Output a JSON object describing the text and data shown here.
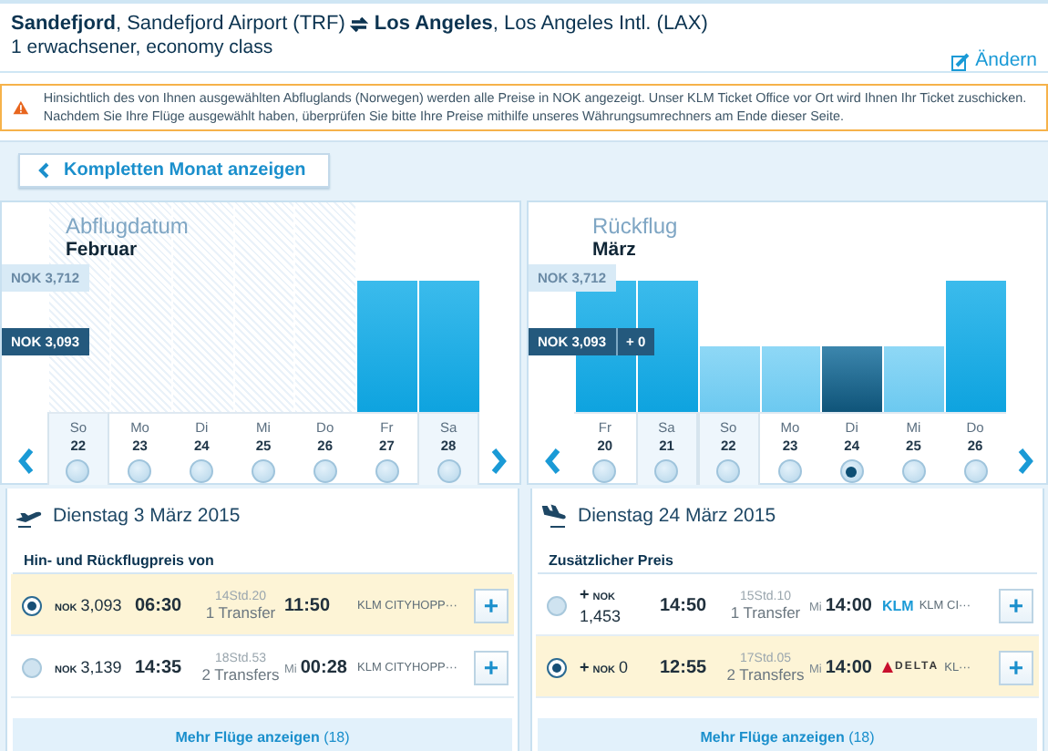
{
  "route": {
    "origin": "**Sandefjord**, Sandefjord Airport (TRF)",
    "destination": "**Los Angeles**, Los Angeles Intl. (LAX)",
    "passengers": "1 erwachsener, economy class",
    "edit_link": "Ändern"
  },
  "notice": {
    "text": "Hinsichtlich des von Ihnen ausgewählten Abfluglands (Norwegen) werden alle Preise in NOK angezeigt. Unser KLM Ticket Office vor Ort wird Ihnen Ihr Ticket zuschicken. Nachdem Sie Ihre Flüge ausgewählt haben, überprüfen Sie bitte Ihre Preise mithilfe unseres Währungsumrechners am Ende dieser Seite."
  },
  "month_button": {
    "label": "Kompletten Monat anzeigen"
  },
  "calendars": [
    {
      "title": "Abflugdatum",
      "month": "Februar",
      "price_tags": [
        {
          "kind": "high",
          "label": "NOK 3,712"
        },
        {
          "kind": "low",
          "label": "NOK 3,093"
        }
      ],
      "days": [
        {
          "weekday": "So",
          "date": "22",
          "kind": "unavailable",
          "weekend": true,
          "selected": false
        },
        {
          "weekday": "Mo",
          "date": "23",
          "kind": "unavailable",
          "weekend": false,
          "selected": false
        },
        {
          "weekday": "Di",
          "date": "24",
          "kind": "unavailable",
          "weekend": false,
          "selected": false
        },
        {
          "weekday": "Mi",
          "date": "25",
          "kind": "unavailable",
          "weekend": false,
          "selected": false
        },
        {
          "weekday": "Do",
          "date": "26",
          "kind": "unavailable",
          "weekend": false,
          "selected": false
        },
        {
          "weekday": "Fr",
          "date": "27",
          "kind": "high",
          "weekend": false,
          "selected": false
        },
        {
          "weekday": "Sa",
          "date": "28",
          "kind": "high",
          "weekend": true,
          "selected": false
        }
      ]
    },
    {
      "title": "Rückflug",
      "month": "März",
      "price_tags": [
        {
          "kind": "high",
          "label": "NOK 3,712"
        },
        {
          "kind": "low",
          "label": "NOK 3,093",
          "extra": "+ 0"
        }
      ],
      "days": [
        {
          "weekday": "Fr",
          "date": "20",
          "kind": "high",
          "weekend": false,
          "selected": false
        },
        {
          "weekday": "Sa",
          "date": "21",
          "kind": "high",
          "weekend": true,
          "selected": false
        },
        {
          "weekday": "So",
          "date": "22",
          "kind": "low",
          "weekend": true,
          "selected": false
        },
        {
          "weekday": "Mo",
          "date": "23",
          "kind": "low",
          "weekend": false,
          "selected": false
        },
        {
          "weekday": "Di",
          "date": "24",
          "kind": "low",
          "weekend": false,
          "selected": true
        },
        {
          "weekday": "Mi",
          "date": "25",
          "kind": "low",
          "weekend": false,
          "selected": false
        },
        {
          "weekday": "Do",
          "date": "26",
          "kind": "high",
          "weekend": false,
          "selected": false
        }
      ]
    }
  ],
  "flight_lists": [
    {
      "kind": "outbound",
      "date": "Dienstag 3 März 2015",
      "subtitle": "Hin- und Rückflugpreis von",
      "more_link": "Mehr Flüge anzeigen",
      "more_count": "(18)",
      "flights": [
        {
          "selected": true,
          "currency": "NOK",
          "price": "3,093",
          "depart": "06:30",
          "duration": "14Std.20",
          "transfers": "1 Transfer",
          "arrive": "11:50",
          "airline": "KLM CITYHOPP···",
          "add": "+"
        },
        {
          "selected": false,
          "currency": "NOK",
          "price": "3,139",
          "depart": "14:35",
          "duration": "18Std.53",
          "transfers": "2 Transfers",
          "arrive_day": "Mi",
          "arrive": "00:28",
          "airline": "KLM CITYHOPP···",
          "add": "+"
        }
      ]
    },
    {
      "kind": "return",
      "date": "Dienstag 24 März 2015",
      "subtitle": "Zusätzlicher Preis",
      "more_link": "Mehr Flüge anzeigen",
      "more_count": "(18)",
      "flights": [
        {
          "selected": false,
          "sign": "+",
          "currency": "NOK",
          "price": "1,453",
          "depart": "14:50",
          "duration": "15Std.10",
          "transfers": "1 Transfer",
          "arrive_day": "Mi",
          "arrive": "14:00",
          "logo": "KLM",
          "kind": "klm",
          "airline": "KLM CI···",
          "add": "+"
        },
        {
          "selected": true,
          "sign": "+",
          "currency": "NOK",
          "price": "0",
          "depart": "12:55",
          "duration": "17Std.05",
          "transfers": "2 Transfers",
          "arrive_day": "Mi",
          "arrive": "14:00",
          "logo": "DELTA",
          "kind": "delta",
          "airline": "KL···",
          "add": "+"
        }
      ]
    }
  ]
}
